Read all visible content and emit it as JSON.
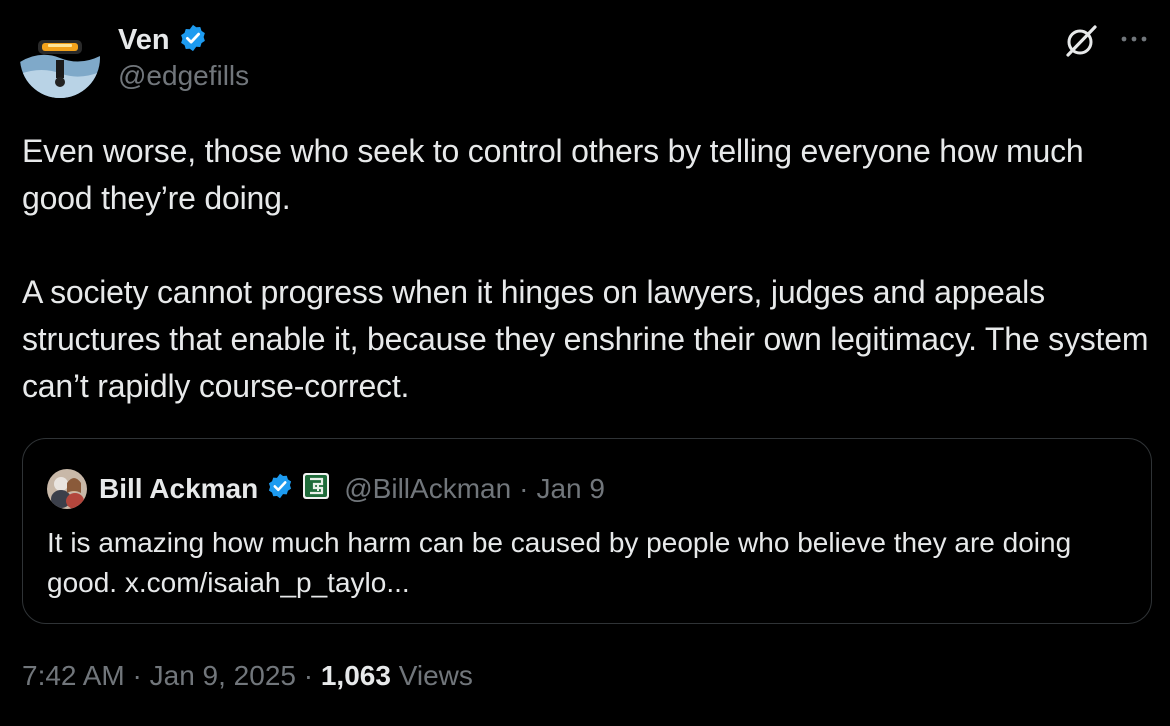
{
  "author": {
    "display_name": "Ven",
    "handle": "@edgefills"
  },
  "tweet": {
    "text": "Even worse, those who seek to control others by telling everyone how much good they’re doing.\n\nA society cannot progress when it hinges on lawyers, judges and appeals structures that enable it, because they enshrine their own legitimacy. The system can’t rapidly course-correct."
  },
  "quote": {
    "display_name": "Bill Ackman",
    "handle": "@BillAckman",
    "separator": "·",
    "date": "Jan 9",
    "text": "It is amazing how much harm can be caused by people who believe they are doing good. x.com/isaiah_p_taylo..."
  },
  "footer": {
    "time": "7:42 AM",
    "separator": "·",
    "date": "Jan 9, 2025",
    "views_count": "1,063",
    "views_label": "Views"
  },
  "icons": {
    "verified": "verified-badge-icon",
    "grok": "grok-icon",
    "more": "more-icon",
    "affiliate": "affiliate-badge-icon"
  },
  "colors": {
    "background": "#000000",
    "text_primary": "#e7e9ea",
    "text_secondary": "#71767b",
    "verified_blue": "#1d9bf0",
    "border": "#2f3336",
    "affiliate_green": "#1f6b3a"
  }
}
